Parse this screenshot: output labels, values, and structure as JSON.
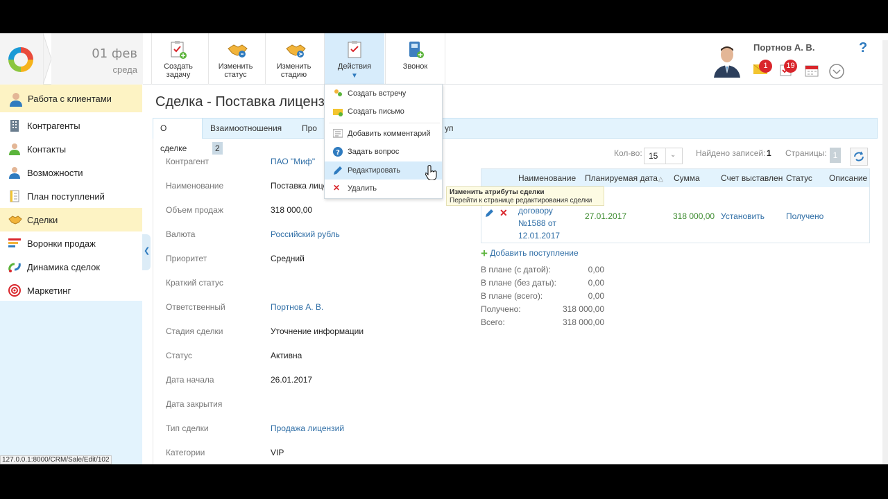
{
  "header": {
    "date": "01 фев",
    "weekday": "среда",
    "toolbar": [
      {
        "label": "Создать задачу",
        "icon": "task-add-icon"
      },
      {
        "label": "Изменить статус",
        "icon": "handshake-icon"
      },
      {
        "label": "Изменить стадию",
        "icon": "handshake-stage-icon"
      },
      {
        "label": "Действия",
        "icon": "actions-clipboard-icon"
      },
      {
        "label": "Звонок",
        "icon": "phone-add-icon"
      }
    ],
    "user_name": "Портнов А. В.",
    "mail_count": "1",
    "tasks_count": "19",
    "help": "?"
  },
  "sidebar": {
    "title": "Работа с клиентами",
    "items": [
      {
        "label": "Контрагенты"
      },
      {
        "label": "Контакты"
      },
      {
        "label": "Возможности"
      },
      {
        "label": "План поступлений"
      },
      {
        "label": "Сделки"
      },
      {
        "label": "Воронки продаж"
      },
      {
        "label": "Динамика сделок"
      },
      {
        "label": "Маркетинг"
      }
    ]
  },
  "page": {
    "title": "Сделка - Поставка лицензий",
    "tabs": [
      {
        "label": "О сделке"
      },
      {
        "label": "Взаимоотношения",
        "count": "2"
      },
      {
        "label": "Про"
      },
      {
        "label": "уп"
      }
    ]
  },
  "fields": [
    {
      "label": "Контрагент",
      "value": "ПАО \"Миф\""
    },
    {
      "label": "Наименование",
      "value": "Поставка лицензий"
    },
    {
      "label": "Объем продаж",
      "value": "318 000,00"
    },
    {
      "label": "Валюта",
      "value": "Российский рубль"
    },
    {
      "label": "Приоритет",
      "value": "Средний"
    },
    {
      "label": "Краткий статус",
      "value": ""
    },
    {
      "label": "Ответственный",
      "value": "Портнов А. В."
    },
    {
      "label": "Стадия сделки",
      "value": "Уточнение информации"
    },
    {
      "label": "Статус",
      "value": "Активна"
    },
    {
      "label": "Дата начала",
      "value": "26.01.2017"
    },
    {
      "label": "Дата закрытия",
      "value": ""
    },
    {
      "label": "Тип сделки",
      "value": "Продажа лицензий"
    },
    {
      "label": "Категории",
      "value": "VIP"
    }
  ],
  "grid": {
    "qty_label": "Кол-во:",
    "qty_value": "15",
    "found_label": "Найдено записей:",
    "found_value": "1",
    "pages_label": "Страницы:",
    "pages_value": "1",
    "columns": [
      "Наименование",
      "Планируемая дата",
      "Сумма",
      "Счет выставлен",
      "Статус",
      "Описание"
    ],
    "row": {
      "name_lines": [
        "договору",
        "№1588 от",
        "12.01.2017"
      ],
      "date": "27.01.2017",
      "sum": "318 000,00",
      "invoice": "Установить",
      "status": "Получено"
    },
    "add_label": "Добавить поступление",
    "summary": [
      {
        "label": "В плане (с датой):",
        "value": "0,00"
      },
      {
        "label": "В плане (без даты):",
        "value": "0,00"
      },
      {
        "label": "В плане (всего):",
        "value": "0,00"
      },
      {
        "label": "Получено:",
        "value": "318 000,00"
      },
      {
        "label": "Всего:",
        "value": "318 000,00"
      }
    ]
  },
  "menu": {
    "items": [
      {
        "label": "Создать встречу",
        "icon": "meeting-icon"
      },
      {
        "label": "Создать письмо",
        "icon": "letter-icon"
      },
      {
        "label": "Добавить комментарий",
        "icon": "comment-icon"
      },
      {
        "label": "Задать вопрос",
        "icon": "question-icon"
      },
      {
        "label": "Редактировать",
        "icon": "pencil-icon"
      },
      {
        "label": "Удалить",
        "icon": "delete-icon"
      }
    ],
    "tooltip_title": "Изменить атрибуты сделки",
    "tooltip_text": "Перейти к странице редактирования сделки"
  },
  "status_url": "127.0.0.1:8000/CRM/Sale/Edit/102",
  "colors": {
    "accent": "#2f6ea6",
    "sidebar_bg": "#e3f3fd",
    "highlight": "#fdf3c4",
    "badge": "#d9262c",
    "green": "#3c8b2f"
  }
}
